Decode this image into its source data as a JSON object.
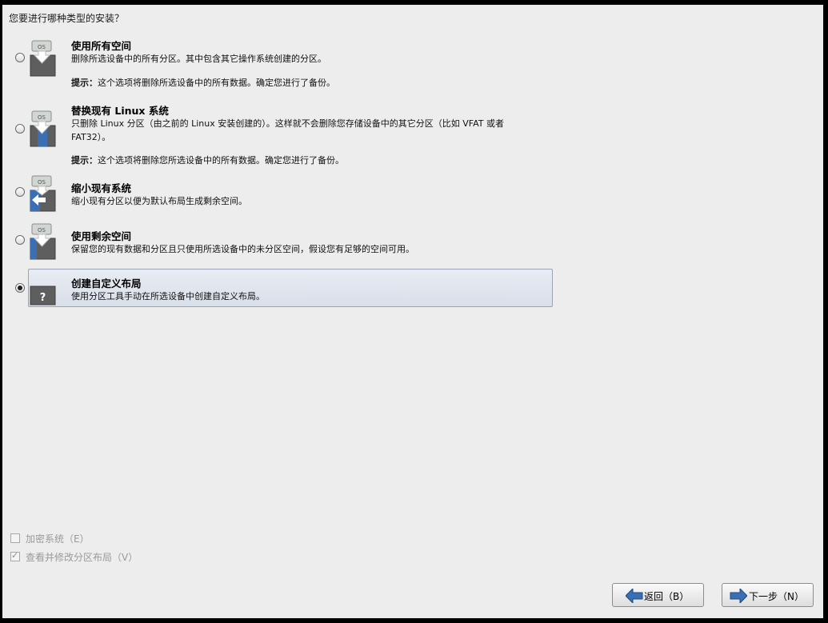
{
  "question": "您要进行哪种类型的安装？",
  "options": [
    {
      "title": "使用所有空间",
      "desc": "删除所选设备中的所有分区。其中包含其它操作系统创建的分区。",
      "tip_label": "提示：",
      "tip_text": "这个选项将删除所选设备中的所有数据。确定您进行了备份。",
      "icon": "use-all-space-icon",
      "icon_badge": "OS",
      "selected": false
    },
    {
      "title": "替换现有 Linux 系统",
      "desc": "只删除 Linux 分区（由之前的 Linux 安装创建的）。这样就不会删除您存储设备中的其它分区（比如 VFAT 或者 FAT32）。",
      "tip_label": "提示：",
      "tip_text": "这个选项将删除您所选设备中的所有数据。确定您进行了备份。",
      "icon": "replace-linux-icon",
      "icon_badge": "OS",
      "selected": false
    },
    {
      "title": "缩小现有系统",
      "desc": "缩小现有分区以便为默认布局生成剩余空间。",
      "icon": "shrink-system-icon",
      "icon_badge": "OS",
      "selected": false
    },
    {
      "title": "使用剩余空间",
      "desc": "保留您的现有数据和分区且只使用所选设备中的未分区空间，假设您有足够的空间可用。",
      "icon": "use-free-space-icon",
      "icon_badge": "OS",
      "selected": false
    },
    {
      "title": "创建自定义布局",
      "desc": "使用分区工具手动在所选设备中创建自定义布局。",
      "icon": "custom-layout-icon",
      "icon_badge": "?",
      "selected": true
    }
  ],
  "checkboxes": [
    {
      "label": "加密系统（E）",
      "checked": false,
      "enabled": false
    },
    {
      "label": "查看并修改分区布局（V）",
      "checked": true,
      "enabled": false
    }
  ],
  "buttons": {
    "back": {
      "label": "返回（B）",
      "icon": "arrow-left-icon"
    },
    "next": {
      "label": "下一步（N）",
      "icon": "arrow-right-icon"
    }
  },
  "colors": {
    "window_bg": "#ededed",
    "selected_row_bg": "#dde2eb",
    "arrow_blue": "#3a6fb4",
    "disk_gray": "#5e5e5e"
  }
}
